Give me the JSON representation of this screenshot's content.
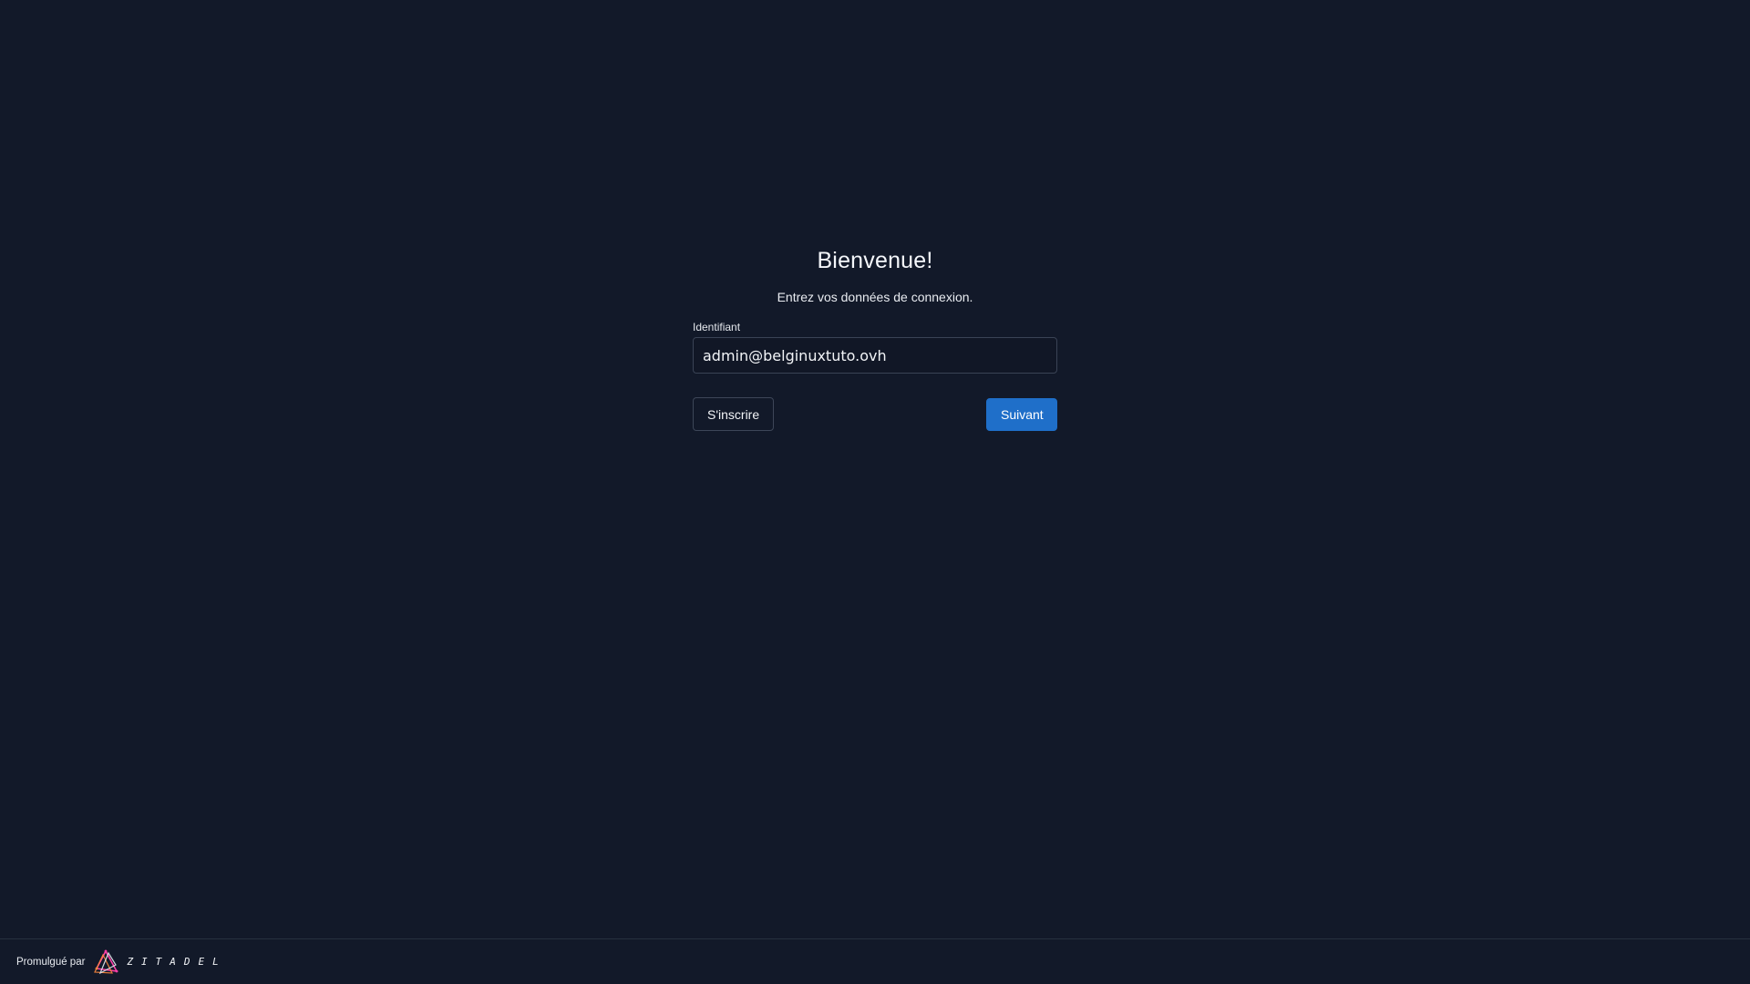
{
  "login": {
    "title": "Bienvenue!",
    "subtitle": "Entrez vos données de connexion.",
    "username_label": "Identifiant",
    "username_value": "admin@belginuxtuto.ovh",
    "register_label": "S'inscrire",
    "next_label": "Suivant"
  },
  "footer": {
    "powered_by": "Promulgué par",
    "brand": "ZITADEL",
    "brand_icon": "zitadel-logo-icon"
  },
  "colors": {
    "background": "#121929",
    "primary": "#1f6fc9",
    "input_border": "#3a4355"
  }
}
